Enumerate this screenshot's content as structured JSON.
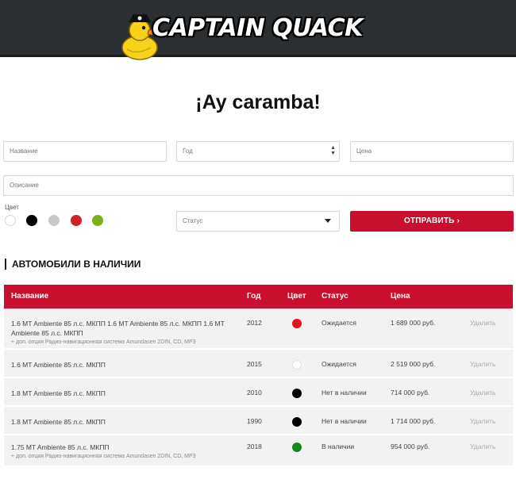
{
  "header": {
    "logo_text": "CAPTAIN QUACK"
  },
  "page": {
    "title": "¡Ay caramba!"
  },
  "form": {
    "name_placeholder": "Название",
    "year_placeholder": "Год",
    "price_placeholder": "Цена",
    "description_placeholder": "Описание",
    "color_label": "Цвет",
    "colors": [
      "#ffffff",
      "#000000",
      "#c8c8c8",
      "#d2232a",
      "#7ab317"
    ],
    "status_placeholder": "Статус",
    "submit_label": "ОТПРАВИТЬ ›"
  },
  "section": {
    "title": "АВТОМОБИЛИ В НАЛИЧИИ"
  },
  "table": {
    "headers": {
      "name": "Название",
      "year": "Год",
      "color": "Цвет",
      "status": "Статус",
      "price": "Цена"
    },
    "rows": [
      {
        "name": "1.6 MT Ambiente 85 л.с. МКПП 1.6 MT Ambiente 85 л.с. МКПП 1.6 MT Ambiente 85 л.с. МКПП",
        "option": "+ доп. опция Радио-навигационная система Amundasen 2DIN, CD, MP3",
        "year": "2012",
        "color": "#e8101a",
        "status": "Ожидается",
        "price": "1 689 000 руб.",
        "delete": "Удалить"
      },
      {
        "name": "1.6 MT Ambiente 85 л.с. МКПП",
        "option": "",
        "year": "2015",
        "color": "#ffffff",
        "status": "Ожидается",
        "price": "2 519 000 руб.",
        "delete": "Удалить"
      },
      {
        "name": "1.8 MT Ambiente 85 л.с. МКПП",
        "option": "",
        "year": "2010",
        "color": "#000000",
        "status": "Нет в наличии",
        "price": "714 000 руб.",
        "delete": "Удалить"
      },
      {
        "name": "1.8 MT Ambiente 85 л.с. МКПП",
        "option": "",
        "year": "1990",
        "color": "#000000",
        "status": "Нет в наличии",
        "price": "1 714 000 руб.",
        "delete": "Удалить"
      },
      {
        "name": "1.75 MT Ambiente 85 л.с. МКПП",
        "option": "+ доп. опция Радио-навигационная система Amundasen 2DIN, CD, MP3",
        "year": "2018",
        "color": "#138a1c",
        "status": "В наличии",
        "price": "954 000 руб.",
        "delete": "Удалить"
      }
    ]
  }
}
